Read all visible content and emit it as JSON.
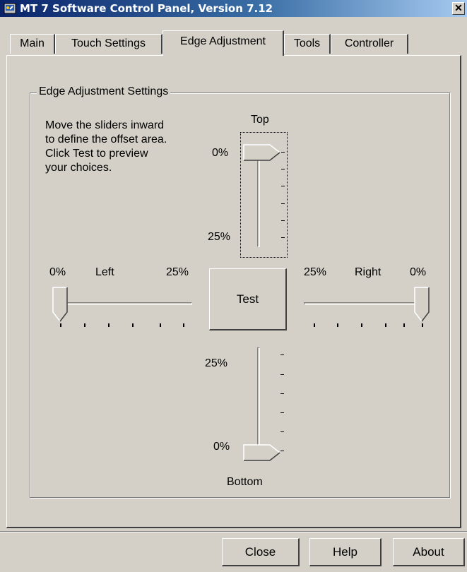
{
  "window": {
    "title": "MT 7 Software Control Panel, Version 7.12",
    "close_glyph": "✕"
  },
  "tabs": [
    {
      "label": "Main"
    },
    {
      "label": "Touch Settings"
    },
    {
      "label": "Edge Adjustment",
      "active": true
    },
    {
      "label": "Tools"
    },
    {
      "label": "Controller"
    }
  ],
  "group": {
    "label": "Edge Adjustment Settings",
    "instructions": [
      "Move the sliders inward",
      "to define the offset area.",
      "Click Test to preview",
      "your choices."
    ]
  },
  "sliders": {
    "top": {
      "label": "Top",
      "min_label": "0%",
      "max_label": "25%",
      "value_percent": 0
    },
    "left": {
      "label": "Left",
      "min_label": "0%",
      "max_label": "25%",
      "value_percent": 0
    },
    "right": {
      "label": "Right",
      "min_label": "25%",
      "max_label": "0%",
      "value_percent": 0
    },
    "bottom": {
      "label": "Bottom",
      "min_label": "25%",
      "max_label": "0%",
      "value_percent": 0
    }
  },
  "test_button": "Test",
  "footer": {
    "close": "Close",
    "help": "Help",
    "about": "About"
  },
  "icons": {
    "app": "control-panel-icon",
    "close": "close-icon"
  },
  "colors": {
    "face": "#d4d0c8",
    "title_start": "#0a246a",
    "title_end": "#a6caf0"
  }
}
